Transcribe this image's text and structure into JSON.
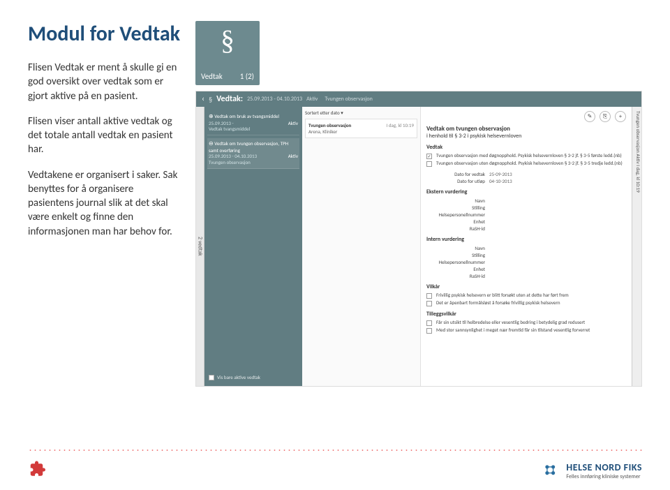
{
  "heading": "Modul for Vedtak",
  "paragraphs": [
    "Flisen Vedtak er ment å skulle gi en god oversikt over vedtak som er gjort aktive på en pasient.",
    "Flisen viser antall aktive vedtak og det totale antall vedtak en pasient har.",
    "Vedtakene er organisert i saker. Sak benyttes for å organisere pasientens journal slik at det skal være enkelt og finne den informasjonen man har behov for."
  ],
  "tile": {
    "label": "Vedtak",
    "count": "1 (2)",
    "icon": "§"
  },
  "app": {
    "header": {
      "title": "Vedtak:",
      "dates": "25.09.2013 - 04.10.2013",
      "status": "Aktiv",
      "subtitle": "Tvungen observasjon"
    },
    "left_count_label": "2 vedtak",
    "list": [
      {
        "name": "Vedtak om bruk av tvangsmiddel",
        "date": "25.09.2013 -",
        "sub": "Vedtak tvangsmiddel",
        "status": "Aktiv"
      },
      {
        "name": "Vedtak om tvungen observasjon, TPH samt overføring",
        "date": "25.09.2013 - 04.10.2013",
        "sub": "Tvungen observasjon",
        "status": "Aktiv"
      }
    ],
    "show_active_label": "Vis bare aktive vedtak",
    "center": {
      "sort_label": "Sortert etter dato ▾",
      "card": {
        "title": "Tvungen observasjon",
        "sub": "Arena, Kliniker",
        "date": "I dag, kl 10:19"
      }
    },
    "detail": {
      "title": "Vedtak om tvungen observasjon",
      "subtitle": "i henhold til § 3-2 i psykisk helsevernloven",
      "vedtak_label": "Vedtak",
      "vedtak_options": [
        {
          "checked": true,
          "text": "Tvungen observasjon med døgnopphold. Psykisk helsevernloven § 3-2 jf. § 3-5 første ledd.(nb)"
        },
        {
          "checked": false,
          "text": "Tvungen observasjon uten døgnopphold. Psykisk helsevernloven § 3-2 jf. § 3-5 tredje ledd.(nb)"
        }
      ],
      "kv": [
        {
          "k": "Dato for vedtak",
          "v": "25-09-2013"
        },
        {
          "k": "Dato for utløp",
          "v": "04-10-2013"
        }
      ],
      "ekstern_label": "Ekstern vurdering",
      "intern_label": "Intern vurdering",
      "vurdering_fields": [
        "Navn",
        "Stilling",
        "Helsepersonellnummer",
        "Enhet",
        "RaSH-id"
      ],
      "vilkar_label": "Vilkår",
      "vilkar": [
        {
          "text": "Frivillig psykisk helsevern er blitt forsøkt uten at dette har ført frem"
        },
        {
          "text": "Det er åpenbart formålsløst å forsøke frivillig psykisk helsevern"
        }
      ],
      "tilleggsvilkar_label": "Tilleggsvilkår",
      "tilleggsvilkar": [
        {
          "text": "Får sin utsikt til helbredelse eller vesentlig bedring i betydelig grad redusert"
        },
        {
          "text": "Med stor sannsynlighet i meget nær fremtid får sin tilstand vesentlig forverret"
        }
      ]
    },
    "side_label": "Tvungen observasjon  Aktiv  I dag, kl 10:19"
  },
  "footer": {
    "logo_line1": "HELSE NORD FIKS",
    "logo_line2": "Felles innføring kliniske systemer"
  }
}
